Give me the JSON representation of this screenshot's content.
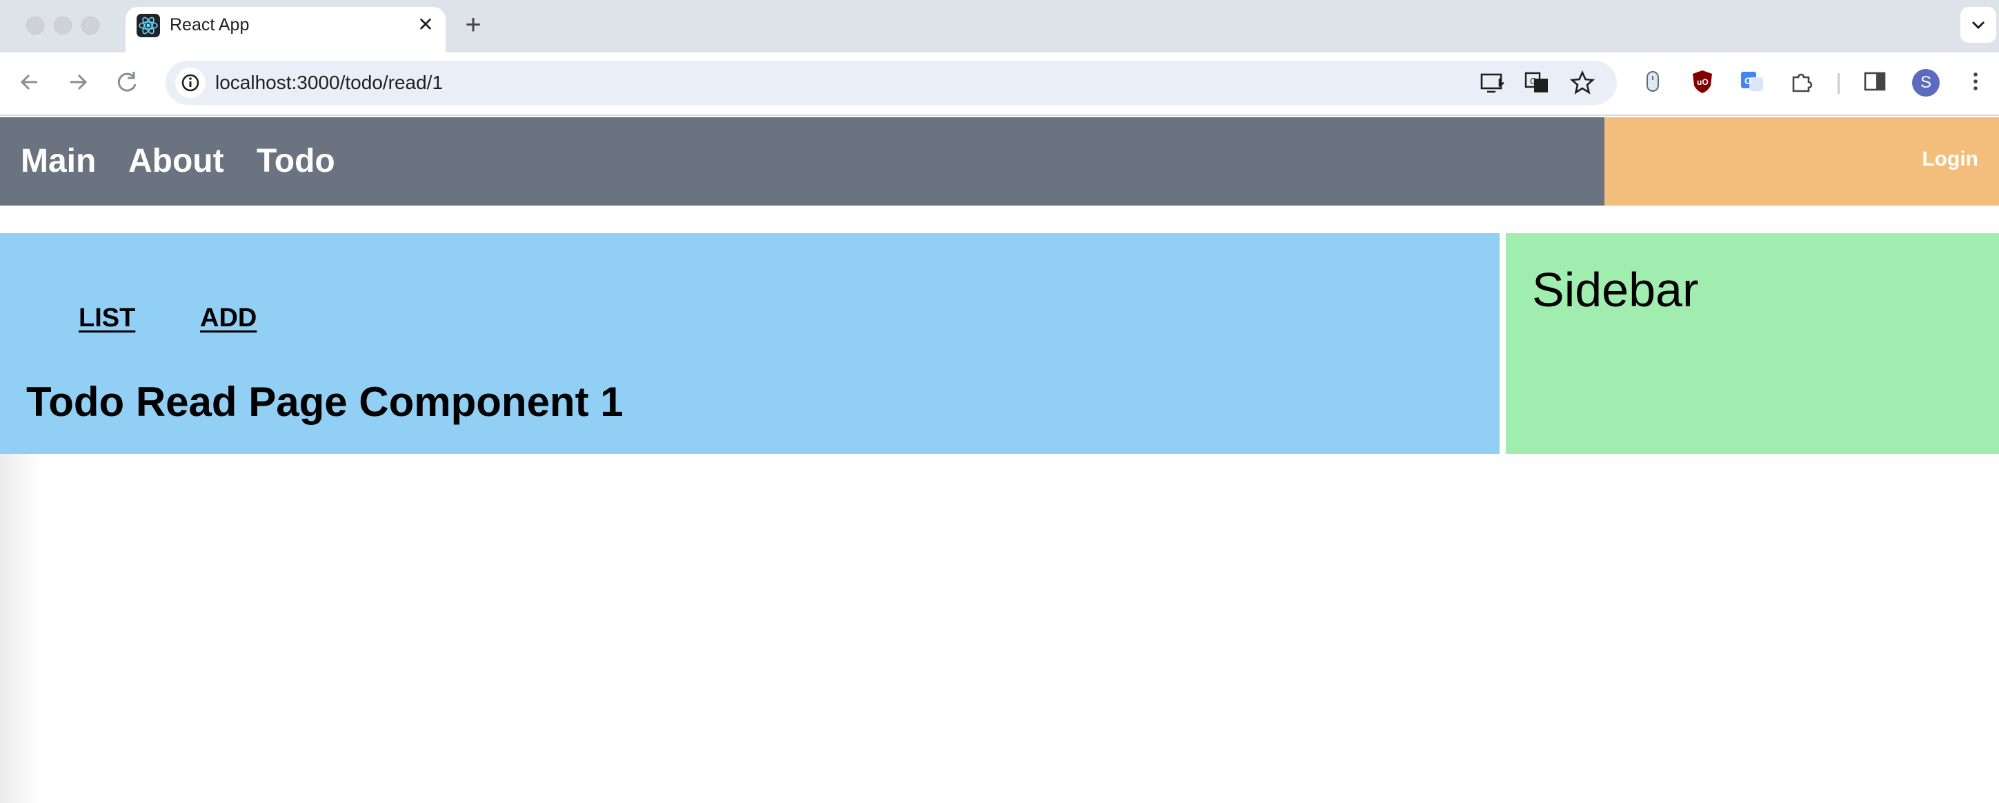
{
  "browser": {
    "tab_title": "React App",
    "tab_close": "✕",
    "new_tab": "+",
    "url": "localhost:3000/todo/read/1",
    "profile_initial": "S",
    "icons": {
      "back": "arrow-left-icon",
      "forward": "arrow-right-icon",
      "reload": "reload-icon",
      "site_info": "info-icon",
      "install": "install-app-icon",
      "translate": "translate-icon",
      "bookmark": "star-icon",
      "extensions": "puzzle-icon",
      "side_panel": "side-panel-icon",
      "menu": "kebab-menu-icon"
    }
  },
  "header": {
    "nav": [
      "Main",
      "About",
      "Todo"
    ],
    "login": "Login"
  },
  "content": {
    "links": [
      "LIST",
      "ADD"
    ],
    "heading": "Todo Read Page Component 1"
  },
  "sidebar": {
    "title": "Sidebar"
  },
  "colors": {
    "header_bg": "#6b7280",
    "login_bg": "#f3bd7c",
    "main_bg": "#91cff5",
    "sidebar_bg": "#a1ecaf",
    "avatar_bg": "#5c6bc0"
  }
}
